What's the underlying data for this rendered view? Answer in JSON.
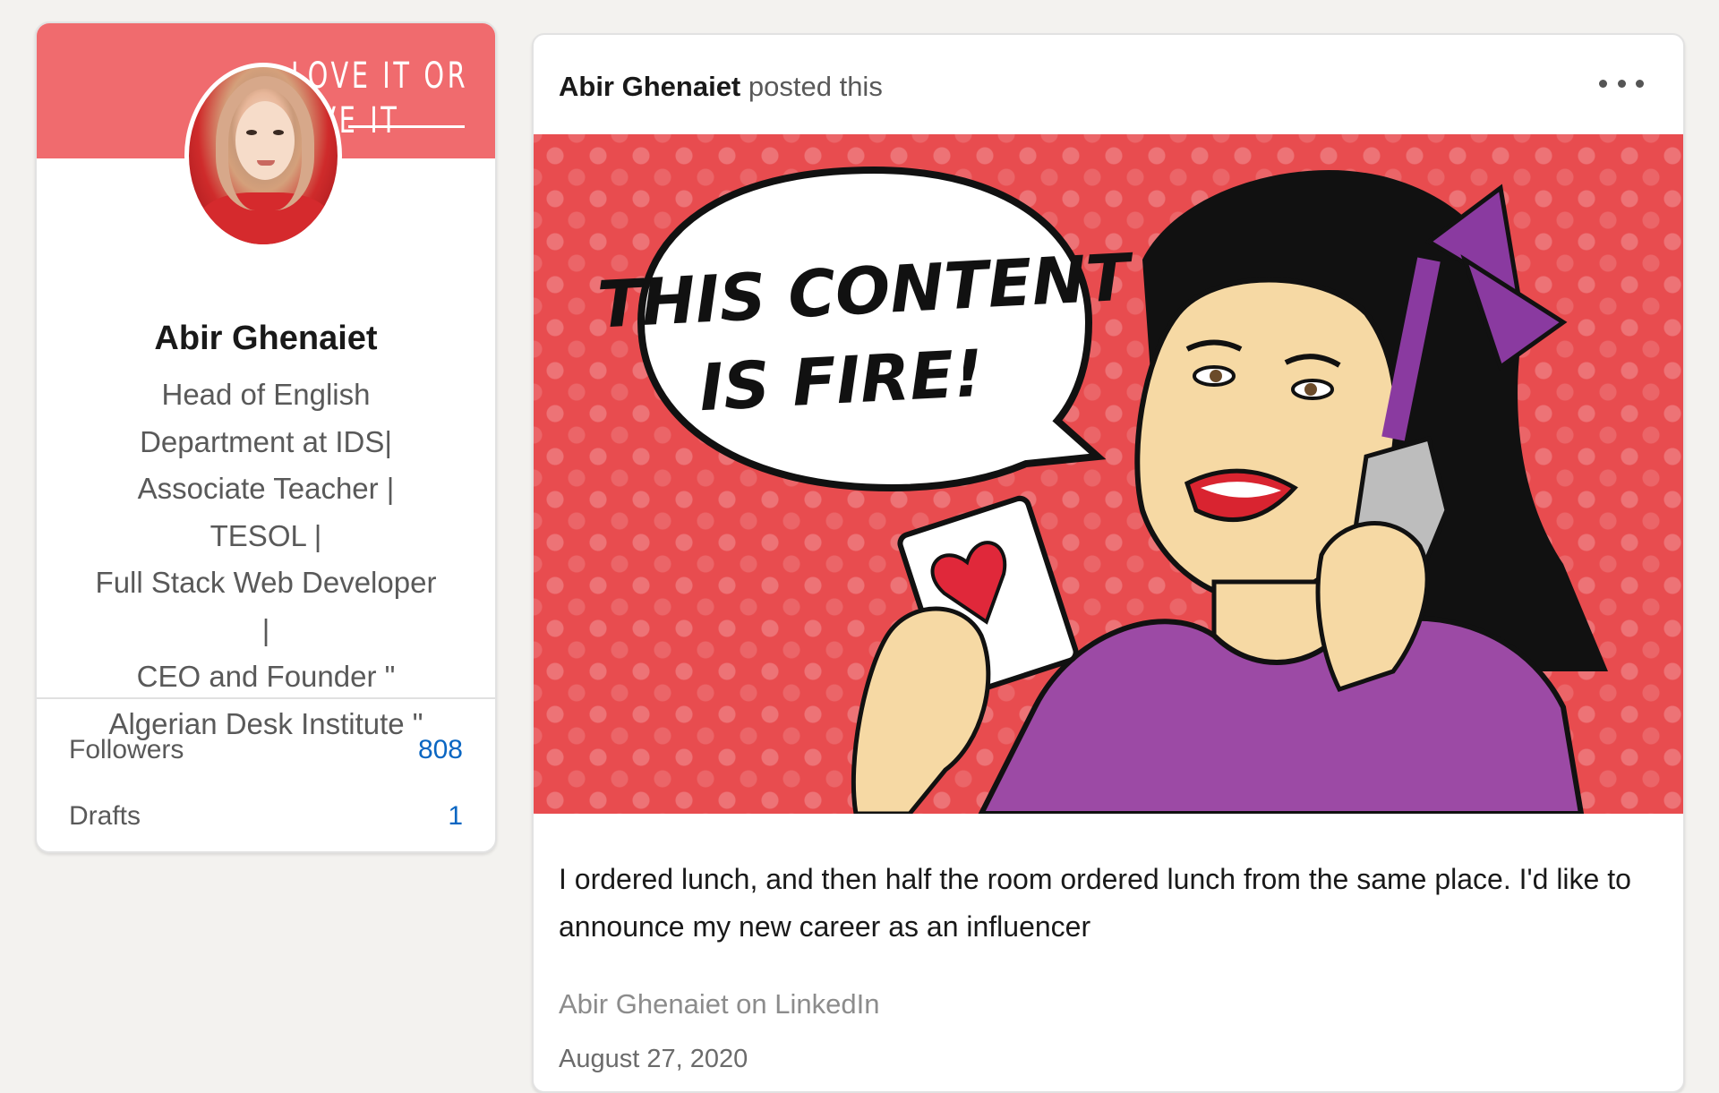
{
  "profile": {
    "cover_line1": "LOVE IT OR",
    "cover_line2": "EAVE IT",
    "name": "Abir Ghenaiet",
    "headline_lines": [
      "Head of English",
      "Department at IDS|",
      "Associate Teacher | TESOL |",
      "Full Stack Web Developer |",
      "CEO and Founder \"",
      "Algerian Desk Institute \""
    ],
    "stats": {
      "followers_label": "Followers",
      "followers_value": "808",
      "drafts_label": "Drafts",
      "drafts_value": "1"
    }
  },
  "post": {
    "author": "Abir Ghenaiet",
    "posted_text": "posted this",
    "more_icon": "more-horizontal-icon",
    "image_caption_line1": "THIS CONTENT",
    "image_caption_line2": "IS FIRE!",
    "body": "I ordered lunch, and then half the room ordered lunch from the same place. I'd like to announce my new career as an influencer",
    "source": "Abir Ghenaiet on LinkedIn",
    "date": "August 27, 2020"
  },
  "colors": {
    "background": "#f3f2ef",
    "cover": "#f06b6e",
    "accent_link": "#0a66c2",
    "image_background": "#e84c4f"
  }
}
